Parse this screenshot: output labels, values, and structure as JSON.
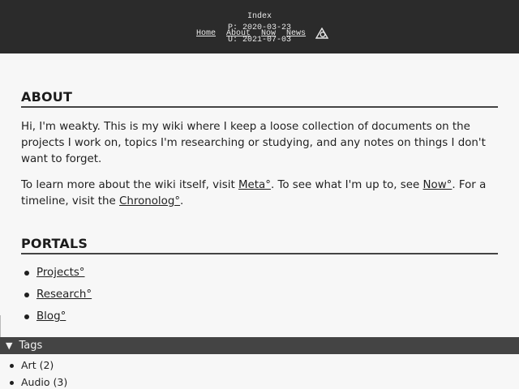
{
  "header": {
    "title": "Index",
    "published": "P: 2020-03-23",
    "updated": "U: 2021-07-03",
    "nav": [
      "Home",
      "About",
      "Now",
      "News"
    ],
    "logo_icon": "triangle-logo-icon"
  },
  "about": {
    "heading": "ABOUT",
    "p1": "Hi, I'm weakty. This is my wiki where I keep a loose collection of documents on the projects I work on, topics I'm researching or studying, and any notes on things I don't want to forget.",
    "p2_a": "To learn more about the wiki itself, visit ",
    "link_meta": "Meta°",
    "p2_b": ". To see what I'm up to, see ",
    "link_now": "Now°",
    "p2_c": ". For a timeline, visit the ",
    "link_chronolog": "Chronolog°",
    "p2_d": "."
  },
  "portals": {
    "heading": "PORTALS",
    "items": [
      "Projects°",
      "Research°",
      "Blog°"
    ]
  },
  "tags": {
    "label": "Tags",
    "items": [
      "Art (2)",
      "Audio (3)"
    ]
  },
  "colors": {
    "header_bg": "#2b2b2b",
    "tags_bar_bg": "#444444",
    "page_bg": "#f7f7f7"
  }
}
